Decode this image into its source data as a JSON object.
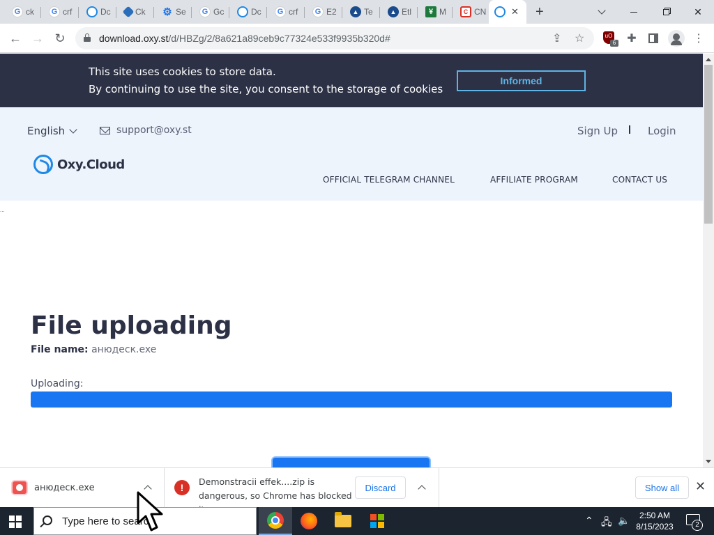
{
  "browser": {
    "tabs": [
      {
        "label": "ck",
        "icon": "google-icon"
      },
      {
        "label": "crf",
        "icon": "google-icon"
      },
      {
        "label": "Dc",
        "icon": "oxy-icon"
      },
      {
        "label": "Ck",
        "icon": "diamond-icon"
      },
      {
        "label": "Se",
        "icon": "gear-icon"
      },
      {
        "label": "Gc",
        "icon": "google-icon"
      },
      {
        "label": "Dc",
        "icon": "oxy-icon"
      },
      {
        "label": "crf",
        "icon": "google-icon"
      },
      {
        "label": "E2",
        "icon": "google-icon"
      },
      {
        "label": "Te",
        "icon": "te-icon"
      },
      {
        "label": "Etl",
        "icon": "te-icon"
      },
      {
        "label": "M",
        "icon": "m-icon"
      },
      {
        "label": "CN",
        "icon": "cn-icon"
      }
    ],
    "active_tab_close": "✕",
    "new_tab": "+",
    "url_host": "download.oxy.st",
    "url_path": "/d/HBZg/2/8a621a89ceb9c77324e533f9935b320d#",
    "ext_badge": "6"
  },
  "cookie_banner": {
    "line1": "This site uses cookies to store data.",
    "line2": "By continuing to use the site, you consent to the storage of cookies",
    "button": "Informed"
  },
  "header": {
    "language": "English",
    "email": "support@oxy.st",
    "sign_up": "Sign Up",
    "login": "Login",
    "logo_text": "Oxy.Cloud",
    "nav": [
      "OFFICIAL TELEGRAM CHANNEL",
      "AFFILIATE PROGRAM",
      "CONTACT US"
    ]
  },
  "main": {
    "title": "File uploading",
    "file_name_label": "File name:",
    "file_name": "анюдеск.exe",
    "uploading_label": "Uploading:",
    "progress_fraction": 1.0,
    "accent_color": "#1976f2",
    "dots": "..."
  },
  "download_shelf": {
    "file1": "анюдеск.exe",
    "warning_line1": "Demonstracii effek....zip is",
    "warning_line2": "dangerous, so Chrome has blocked it.",
    "warning_icon": "!",
    "discard": "Discard",
    "show_all": "Show all",
    "close": "✕"
  },
  "taskbar": {
    "search_placeholder": "Type here to search",
    "time": "2:50 AM",
    "date": "8/15/2023",
    "notifications": "2"
  }
}
